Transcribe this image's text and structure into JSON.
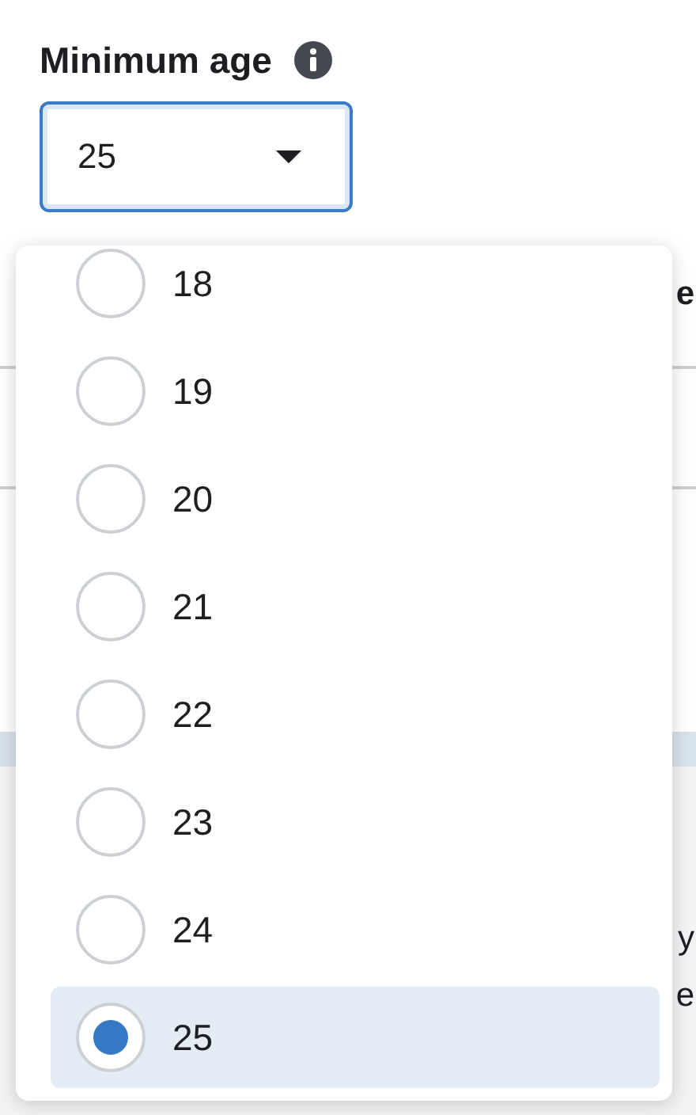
{
  "field": {
    "label": "Minimum age",
    "value": "25"
  },
  "background_fragments": [
    "e",
    "y",
    "e"
  ],
  "options": [
    {
      "label": "18",
      "selected": false
    },
    {
      "label": "19",
      "selected": false
    },
    {
      "label": "20",
      "selected": false
    },
    {
      "label": "21",
      "selected": false
    },
    {
      "label": "22",
      "selected": false
    },
    {
      "label": "23",
      "selected": false
    },
    {
      "label": "24",
      "selected": false
    },
    {
      "label": "25",
      "selected": true
    }
  ]
}
